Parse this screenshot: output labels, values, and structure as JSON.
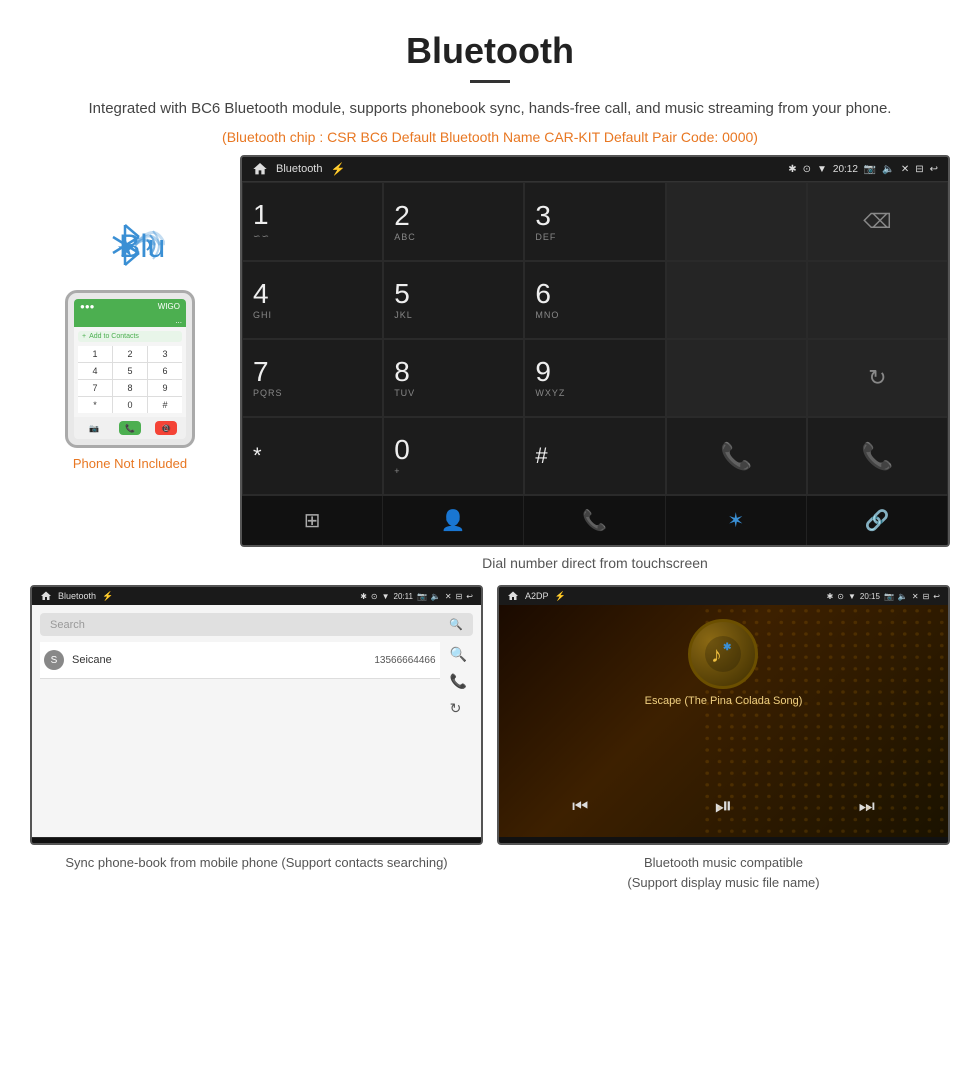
{
  "header": {
    "title": "Bluetooth",
    "subtitle": "Integrated with BC6 Bluetooth module, supports phonebook sync, hands-free call, and music streaming from your phone.",
    "specs": "(Bluetooth chip : CSR BC6    Default Bluetooth Name CAR-KIT    Default Pair Code: 0000)"
  },
  "phone_label": "Phone Not Included",
  "car_screen_main": {
    "status_bar": {
      "label": "Bluetooth",
      "time": "20:12"
    },
    "dialpad": [
      {
        "digit": "1",
        "sub": ""
      },
      {
        "digit": "2",
        "sub": "ABC"
      },
      {
        "digit": "3",
        "sub": "DEF"
      },
      {
        "digit": "",
        "sub": ""
      },
      {
        "digit": "⌫",
        "sub": ""
      },
      {
        "digit": "4",
        "sub": "GHI"
      },
      {
        "digit": "5",
        "sub": "JKL"
      },
      {
        "digit": "6",
        "sub": "MNO"
      },
      {
        "digit": "",
        "sub": ""
      },
      {
        "digit": "",
        "sub": ""
      },
      {
        "digit": "7",
        "sub": "PQRS"
      },
      {
        "digit": "8",
        "sub": "TUV"
      },
      {
        "digit": "9",
        "sub": "WXYZ"
      },
      {
        "digit": "",
        "sub": ""
      },
      {
        "digit": "↺",
        "sub": ""
      },
      {
        "digit": "*",
        "sub": ""
      },
      {
        "digit": "0",
        "sub": "+"
      },
      {
        "digit": "#",
        "sub": ""
      },
      {
        "digit": "📞",
        "sub": ""
      },
      {
        "digit": "📞red",
        "sub": ""
      }
    ],
    "caption": "Dial number direct from touchscreen"
  },
  "phonebook_screen": {
    "status_label": "Bluetooth",
    "time": "20:11",
    "search_placeholder": "Search",
    "contacts": [
      {
        "letter": "S",
        "name": "Seicane",
        "number": "13566664466"
      }
    ]
  },
  "music_screen": {
    "status_label": "A2DP",
    "time": "20:15",
    "song_title": "Escape (The Pina Colada Song)"
  },
  "bottom_captions": {
    "phonebook": "Sync phone-book from mobile phone\n(Support contacts searching)",
    "music": "Bluetooth music compatible\n(Support display music file name)"
  }
}
